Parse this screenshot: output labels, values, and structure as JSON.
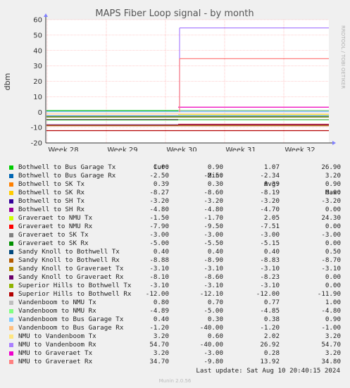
{
  "chart_data": {
    "type": "line",
    "title": "MAPS Fiber Loop signal - by month",
    "ylabel": "dbm",
    "side_label": "RRDTOOL / TOBI OETIKER",
    "ylim": [
      -20,
      60
    ],
    "yticks": [
      -20,
      -10,
      0,
      10,
      20,
      30,
      40,
      50,
      60
    ],
    "xticks": [
      "Week 28",
      "Week 29",
      "Week 30",
      "Week 31",
      "Week 32"
    ],
    "grid": true,
    "colors": {
      "background": "#ffffff",
      "grid": "#ff9f9f",
      "zero_line": "#cccccc",
      "axis": "#333333"
    },
    "series": [
      {
        "name": "Bothwell to Bus Garage Tx",
        "color": "#00cc00",
        "y_before": 1.0,
        "y_after": 1.0
      },
      {
        "name": "Bothwell to Bus Garage Rx",
        "color": "#0066b3",
        "y_before": -2.5,
        "y_after": -2.5
      },
      {
        "name": "Bothwell to SK Tx",
        "color": "#ff8000",
        "y_before": 0.39,
        "y_after": 0.39
      },
      {
        "name": "Bothwell to SK Rx",
        "color": "#ffcc00",
        "y_before": -8.2,
        "y_after": -8.27
      },
      {
        "name": "Bothwell to SH Tx",
        "color": "#330099",
        "y_before": -3.2,
        "y_after": -3.2
      },
      {
        "name": "Bothwell to SH Rx",
        "color": "#990099",
        "y_before": -4.8,
        "y_after": -4.8
      },
      {
        "name": "Graveraet to NMU Tx",
        "color": "#ccff00",
        "y_before": null,
        "y_after": -1.5
      },
      {
        "name": "Graveraet to NMU Rx",
        "color": "#ff0000",
        "y_before": null,
        "y_after": -7.9
      },
      {
        "name": "Graveraet to SK Tx",
        "color": "#808080",
        "y_before": -3.0,
        "y_after": -3.0
      },
      {
        "name": "Graveraet to SK Rx",
        "color": "#008f00",
        "y_before": -5.0,
        "y_after": -5.0
      },
      {
        "name": "Sandy Knoll to Bothwell Tx",
        "color": "#00487d",
        "y_before": 0.4,
        "y_after": 0.4
      },
      {
        "name": "Sandy Knoll to Bothwell Rx",
        "color": "#b35a00",
        "y_before": -8.85,
        "y_after": -8.88
      },
      {
        "name": "Sandy Knoll to Graveraet Tx",
        "color": "#b38f00",
        "y_before": -3.1,
        "y_after": -3.1
      },
      {
        "name": "Sandy Knoll to Graveraet Rx",
        "color": "#6b006b",
        "y_before": -8.2,
        "y_after": -8.1
      },
      {
        "name": "Superior Hills to Bothwell Tx",
        "color": "#8fb300",
        "y_before": -3.1,
        "y_after": -3.1
      },
      {
        "name": "Superior Hills to Bothwell Rx",
        "color": "#b30000",
        "y_before": -12.0,
        "y_after": -12.0
      },
      {
        "name": "Vandenboom to NMU Tx",
        "color": "#bebebe",
        "y_before": null,
        "y_after": 0.8
      },
      {
        "name": "Vandenboom to NMU Rx",
        "color": "#80ff80",
        "y_before": null,
        "y_after": -4.89
      },
      {
        "name": "Vandenboom to Bus Garage Tx",
        "color": "#80c9ff",
        "y_before": 0.4,
        "y_after": 0.4
      },
      {
        "name": "Vandenboom to Bus Garage Rx",
        "color": "#ffc080",
        "y_before": -1.2,
        "y_after": -1.2
      },
      {
        "name": "NMU to Vandenboom Tx",
        "color": "#ffe680",
        "y_before": null,
        "y_after": 3.2
      },
      {
        "name": "NMU to Vandenboom Rx",
        "color": "#aa80ff",
        "y_before": null,
        "y_after": 54.7
      },
      {
        "name": "NMU to Graveraet Tx",
        "color": "#ee00cc",
        "y_before": null,
        "y_after": 3.2
      },
      {
        "name": "NMU to Graveraet Rx",
        "color": "#ff8080",
        "y_before": null,
        "y_after": 34.7
      }
    ]
  },
  "legend": {
    "headers": [
      "Cur:",
      "Min:",
      "Avg:",
      "Max:"
    ],
    "rows": [
      {
        "name": "Bothwell to Bus Garage Tx",
        "color": "#00cc00",
        "cur": "1.00",
        "min": "0.90",
        "avg": "1.07",
        "max": "26.90"
      },
      {
        "name": "Bothwell to Bus Garage Rx",
        "color": "#0066b3",
        "cur": "-2.50",
        "min": "-2.50",
        "avg": "-2.34",
        "max": "3.20"
      },
      {
        "name": "Bothwell to SK Tx",
        "color": "#ff8000",
        "cur": "0.39",
        "min": "0.30",
        "avg": "0.39",
        "max": "0.90"
      },
      {
        "name": "Bothwell to SK Rx",
        "color": "#ffcc00",
        "cur": "-8.27",
        "min": "-8.60",
        "avg": "-8.19",
        "max": "0.00"
      },
      {
        "name": "Bothwell to SH Tx",
        "color": "#330099",
        "cur": "-3.20",
        "min": "-3.20",
        "avg": "-3.20",
        "max": "-3.20"
      },
      {
        "name": "Bothwell to SH Rx",
        "color": "#990099",
        "cur": "-4.80",
        "min": "-4.80",
        "avg": "-4.70",
        "max": "0.00"
      },
      {
        "name": "Graveraet to NMU Tx",
        "color": "#ccff00",
        "cur": "-1.50",
        "min": "-1.70",
        "avg": "2.05",
        "max": "24.30"
      },
      {
        "name": "Graveraet to NMU Rx",
        "color": "#ff0000",
        "cur": "-7.90",
        "min": "-9.50",
        "avg": "-7.51",
        "max": "0.00"
      },
      {
        "name": "Graveraet to SK Tx",
        "color": "#808080",
        "cur": "-3.00",
        "min": "-3.00",
        "avg": "-3.00",
        "max": "-3.00"
      },
      {
        "name": "Graveraet to SK Rx",
        "color": "#008f00",
        "cur": "-5.00",
        "min": "-5.50",
        "avg": "-5.15",
        "max": "0.00"
      },
      {
        "name": "Sandy Knoll to Bothwell Tx",
        "color": "#00487d",
        "cur": "0.40",
        "min": "0.40",
        "avg": "0.40",
        "max": "0.50"
      },
      {
        "name": "Sandy Knoll to Bothwell Rx",
        "color": "#b35a00",
        "cur": "-8.88",
        "min": "-8.90",
        "avg": "-8.83",
        "max": "-8.70"
      },
      {
        "name": "Sandy Knoll to Graveraet Tx",
        "color": "#b38f00",
        "cur": "-3.10",
        "min": "-3.10",
        "avg": "-3.10",
        "max": "-3.10"
      },
      {
        "name": "Sandy Knoll to Graveraet Rx",
        "color": "#6b006b",
        "cur": "-8.10",
        "min": "-8.60",
        "avg": "-8.23",
        "max": "0.00"
      },
      {
        "name": "Superior Hills to Bothwell Tx",
        "color": "#8fb300",
        "cur": "-3.10",
        "min": "-3.10",
        "avg": "-3.10",
        "max": "0.00"
      },
      {
        "name": "Superior Hills to Bothwell Rx",
        "color": "#b30000",
        "cur": "-12.00",
        "min": "-12.10",
        "avg": "-12.00",
        "max": "-11.90"
      },
      {
        "name": "Vandenboom to NMU Tx",
        "color": "#bebebe",
        "cur": "0.80",
        "min": "0.70",
        "avg": "0.77",
        "max": "1.00"
      },
      {
        "name": "Vandenboom to NMU Rx",
        "color": "#80ff80",
        "cur": "-4.89",
        "min": "-5.00",
        "avg": "-4.85",
        "max": "-4.80"
      },
      {
        "name": "Vandenboom to Bus Garage Tx",
        "color": "#80c9ff",
        "cur": "0.40",
        "min": "0.30",
        "avg": "0.38",
        "max": "0.90"
      },
      {
        "name": "Vandenboom to Bus Garage Rx",
        "color": "#ffc080",
        "cur": "-1.20",
        "min": "-40.00",
        "avg": "-1.20",
        "max": "-1.00"
      },
      {
        "name": "NMU to Vandenboom Tx",
        "color": "#ffe680",
        "cur": "3.20",
        "min": "0.60",
        "avg": "2.02",
        "max": "3.20"
      },
      {
        "name": "NMU to Vandenboom Rx",
        "color": "#aa80ff",
        "cur": "54.70",
        "min": "-40.00",
        "avg": "26.92",
        "max": "54.70"
      },
      {
        "name": "NMU to Graveraet Tx",
        "color": "#ee00cc",
        "cur": "3.20",
        "min": "-3.00",
        "avg": "0.28",
        "max": "3.20"
      },
      {
        "name": "NMU to Graveraet Rx",
        "color": "#ff8080",
        "cur": "34.70",
        "min": "-9.80",
        "avg": "13.92",
        "max": "34.80"
      }
    ]
  },
  "footer": {
    "last_update": "Last update: Sat Aug 10 20:40:15 2024",
    "version": "Munin 2.0.56"
  }
}
